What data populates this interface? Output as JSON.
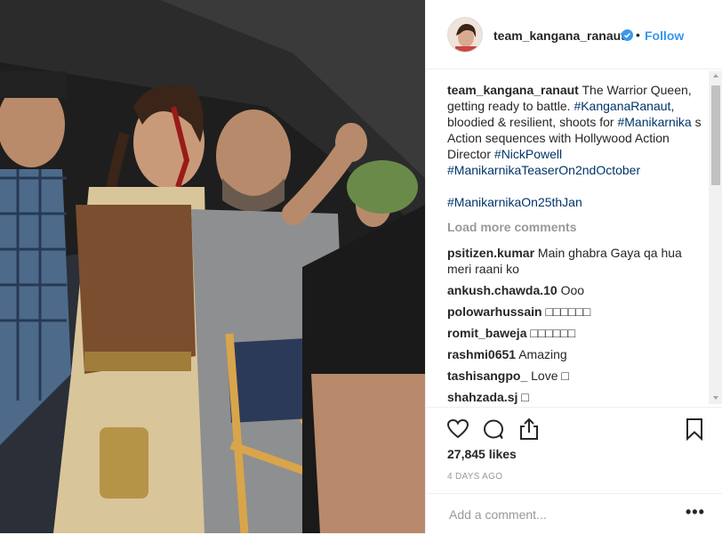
{
  "post": {
    "author": "team_kangana_ranaut",
    "follow_label": "Follow",
    "separator": "•",
    "colors": {
      "accent": "#3897f0",
      "hashtag": "#003569",
      "muted": "#999999",
      "text": "#262626"
    }
  },
  "caption": {
    "username": "team_kangana_ranaut",
    "text_1": " The Warrior Queen, getting ready to battle. ",
    "tag_1": "#KanganaRanaut",
    "text_2": ", bloodied & resilient, shoots for ",
    "tag_2": "#Manikarnika",
    "text_3": " s Action sequences with Hollywood Action Director ",
    "tag_3": "#NickPowell",
    "text_4": " ",
    "tag_4": "#ManikarnikaTeaserOn2ndOctober",
    "tag_5": "#ManikarnikaOn25thJan"
  },
  "load_more": "Load more comments",
  "comments": [
    {
      "user": "psitizen.kumar",
      "text": "Main ghabra Gaya qa hua meri raani ko"
    },
    {
      "user": "ankush.chawda.10",
      "text": "Ooo"
    },
    {
      "user": "polowarhussain",
      "text": "□□□□□□"
    },
    {
      "user": "romit_baweja",
      "text": "□□□□□□"
    },
    {
      "user": "rashmi0651",
      "text": "Amazing"
    },
    {
      "user": "tashisangpo_",
      "text": "Love □"
    },
    {
      "user": "shahzada.sj",
      "text": "□"
    }
  ],
  "likes": "27,845 likes",
  "date": "4 DAYS AGO",
  "add_comment": {
    "placeholder": "Add a comment..."
  },
  "more": "•••",
  "icons": [
    "verified-icon",
    "heart-icon",
    "comment-icon",
    "share-icon",
    "bookmark-icon"
  ]
}
